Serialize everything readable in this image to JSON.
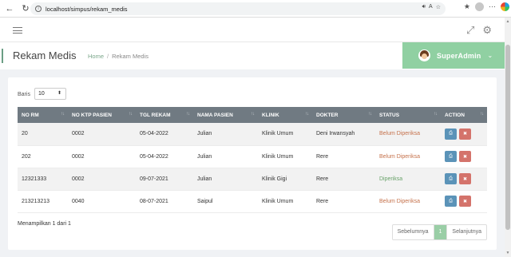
{
  "browser": {
    "url": "localhost/simpus/rekam_medis"
  },
  "header": {
    "page_title": "Rekam Medis",
    "breadcrumb_home": "Home",
    "breadcrumb_sep": "/",
    "breadcrumb_current": "Rekam Medis"
  },
  "user": {
    "name": "SuperAdmin"
  },
  "filter": {
    "baris_label": "Baris",
    "baris_value": "10"
  },
  "table": {
    "columns": [
      "NO RM",
      "NO KTP PASIEN",
      "TGL REKAM",
      "NAMA PASIEN",
      "KLINIK",
      "DOKTER",
      "STATUS",
      "ACTION"
    ],
    "rows": [
      {
        "no_rm": "20",
        "no_ktp": "0002",
        "tgl": "05-04-2022",
        "nama": "Julian",
        "klinik": "Klinik Umum",
        "dokter": "Deni Irwansyah",
        "status": "Belum Diperiksa"
      },
      {
        "no_rm": "202",
        "no_ktp": "0002",
        "tgl": "05-04-2022",
        "nama": "Julian",
        "klinik": "Klinik Umum",
        "dokter": "Rere",
        "status": "Belum Diperiksa"
      },
      {
        "no_rm": "12321333",
        "no_ktp": "0002",
        "tgl": "09-07-2021",
        "nama": "Julian",
        "klinik": "Klinik Gigi",
        "dokter": "Rere",
        "status": "Diperiksa"
      },
      {
        "no_rm": "213213213",
        "no_ktp": "0040",
        "tgl": "08-07-2021",
        "nama": "Saipul",
        "klinik": "Klinik Umum",
        "dokter": "Rere",
        "status": "Belum Diperiksa"
      }
    ]
  },
  "footer": {
    "showing": "Menampilkan 1 dari 1",
    "prev": "Sebelumnya",
    "page": "1",
    "next": "Selanjutnya"
  },
  "colors": {
    "accent": "#90d0a2",
    "header_row": "#707a82",
    "status_pending": "#c5714b",
    "status_done": "#6aa36b"
  }
}
